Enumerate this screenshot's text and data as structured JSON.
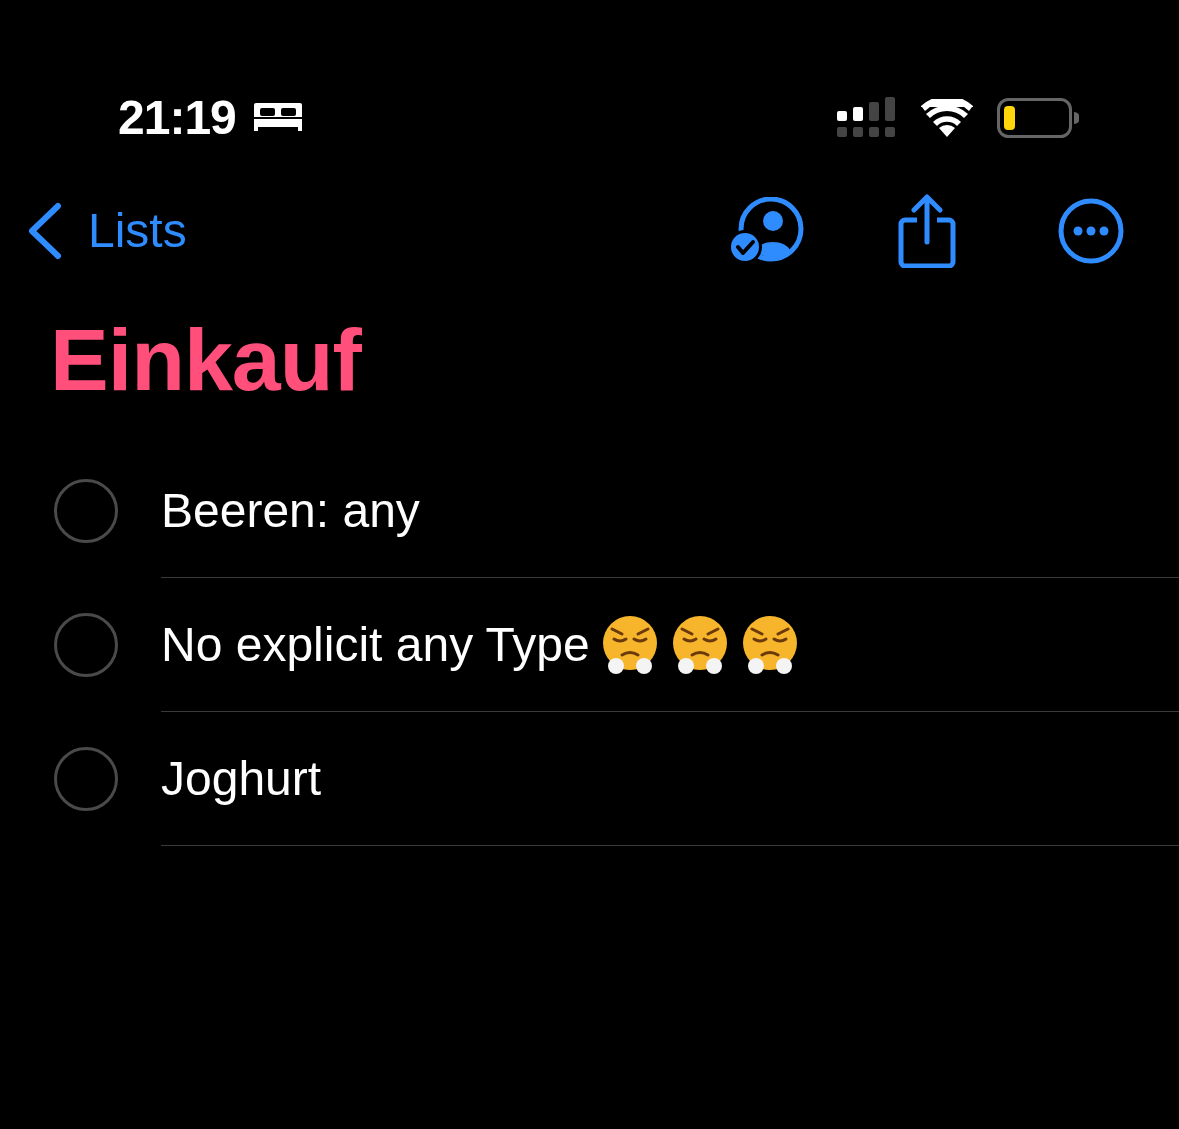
{
  "status_bar": {
    "time": "21:19"
  },
  "nav": {
    "back_label": "Lists"
  },
  "title": "Einkauf",
  "items": [
    {
      "text": "Beeren: any",
      "checked": false
    },
    {
      "text": "No explicit any Type",
      "checked": false,
      "icons": [
        {
          "kind": "steam-face"
        },
        {
          "kind": "steam-face"
        },
        {
          "kind": "steam-face"
        }
      ]
    },
    {
      "text": "Joghurt",
      "checked": false
    }
  ]
}
